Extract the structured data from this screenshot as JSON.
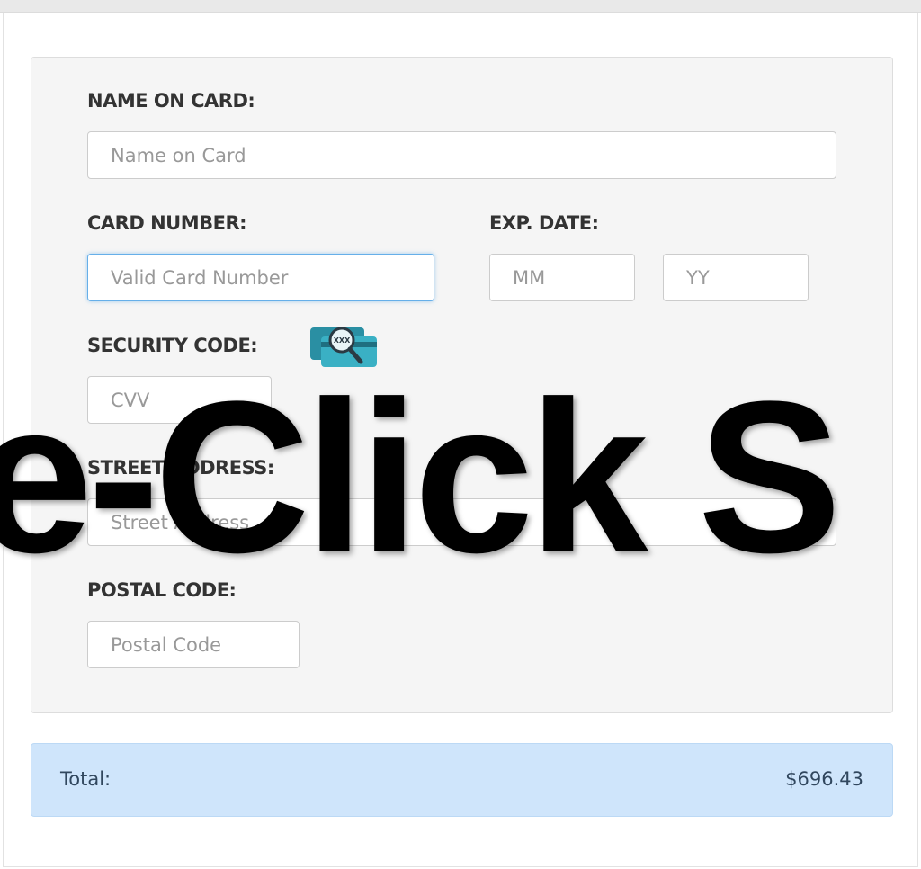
{
  "form": {
    "name_label": "NAME ON CARD:",
    "name_placeholder": "Name on Card",
    "card_number_label": "CARD NUMBER:",
    "card_number_placeholder": "Valid Card Number",
    "exp_date_label": "EXP. DATE:",
    "exp_month_placeholder": "MM",
    "exp_year_placeholder": "YY",
    "security_code_label": "SECURITY CODE:",
    "security_icon_text": "XXX",
    "cvv_placeholder": "CVV",
    "street_label": "STREET ADDRESS:",
    "street_placeholder": "Street Address",
    "postal_label": "POSTAL CODE:",
    "postal_placeholder": "Postal Code"
  },
  "summary": {
    "total_label": "Total:",
    "total_value": "$696.43"
  },
  "overlay": {
    "text": "e-Click S"
  },
  "colors": {
    "panel_bg": "#f5f5f5",
    "total_bg": "#cfe5fb",
    "focus_border": "#66afe9",
    "icon_teal": "#3ab0c4"
  },
  "icons": {
    "security": "card-magnifier-icon"
  }
}
